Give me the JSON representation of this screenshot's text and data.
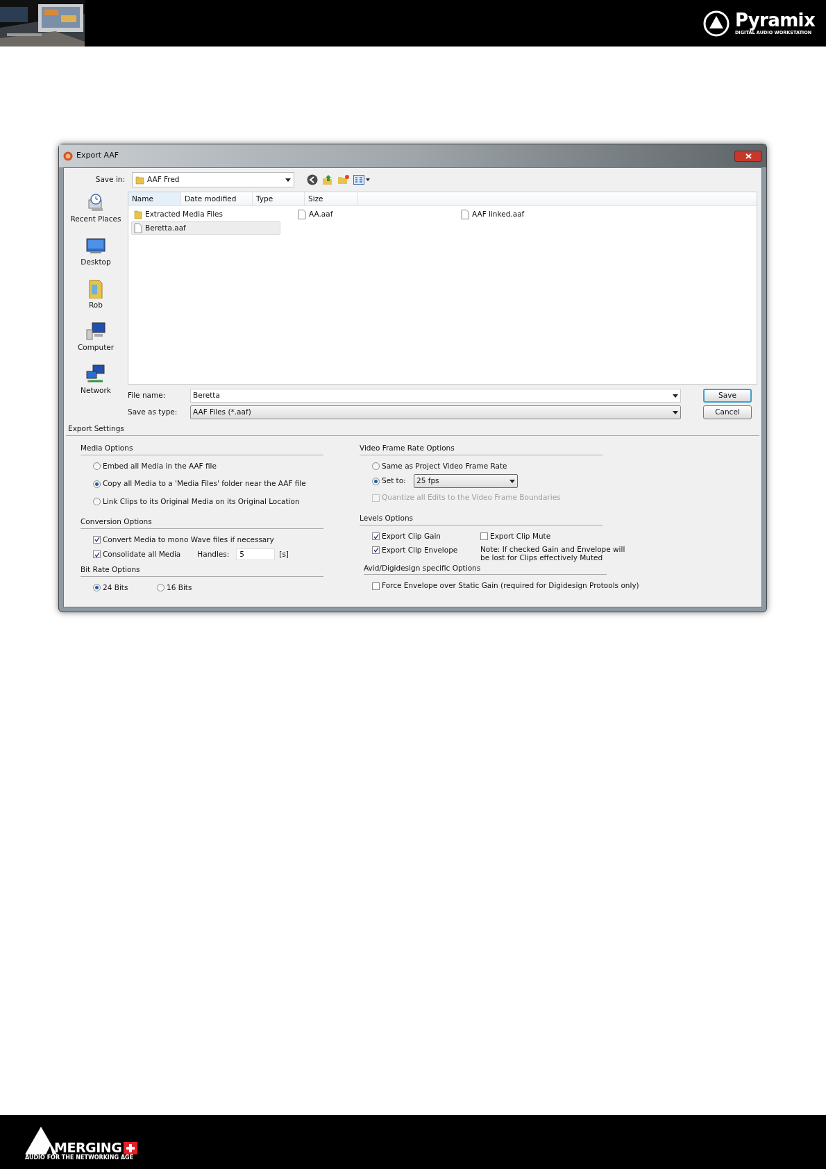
{
  "page_header": {
    "product": "Pyramix",
    "tagline": "DIGITAL AUDIO WORKSTATION"
  },
  "dialog": {
    "title": "Export AAF",
    "save_in": {
      "label": "Save in:",
      "value": "AAF Fred"
    },
    "places": [
      {
        "label": "Recent Places",
        "kind": "recent"
      },
      {
        "label": "Desktop",
        "kind": "desktop"
      },
      {
        "label": "Rob",
        "kind": "user"
      },
      {
        "label": "Computer",
        "kind": "computer"
      },
      {
        "label": "Network",
        "kind": "network"
      }
    ],
    "columns": [
      "Name",
      "Date modified",
      "Type",
      "Size"
    ],
    "files": [
      {
        "name": "Extracted Media Files",
        "kind": "folder",
        "selected": false
      },
      {
        "name": "AA.aaf",
        "kind": "file",
        "selected": false
      },
      {
        "name": "AAF linked.aaf",
        "kind": "file",
        "selected": false
      },
      {
        "name": "Beretta.aaf",
        "kind": "file",
        "selected": true
      }
    ],
    "file_name": {
      "label": "File name:",
      "value": "Beretta"
    },
    "save_as_type": {
      "label": "Save as type:",
      "value": "AAF Files (*.aaf)"
    },
    "buttons": [
      "Save",
      "Cancel"
    ],
    "export_settings": {
      "title": "Export Settings",
      "media_options": {
        "title": "Media Options",
        "options": [
          {
            "label": "Embed all Media in the AAF file",
            "selected": false
          },
          {
            "label": "Copy all Media to a 'Media Files' folder near the AAF file",
            "selected": true
          },
          {
            "label": "Link Clips to its Original Media on its Original Location",
            "selected": false
          }
        ]
      },
      "conversion_options": {
        "title": "Conversion Options",
        "convert": {
          "label": "Convert Media to mono Wave files if necessary",
          "checked": true
        },
        "consolidate": {
          "label": "Consolidate all Media",
          "checked": true
        },
        "handles": {
          "label": "Handles:",
          "value": "5",
          "unit": "[s]"
        }
      },
      "bit_rate_options": {
        "title": "Bit Rate Options",
        "options": [
          {
            "label": "24 Bits",
            "selected": true
          },
          {
            "label": "16 Bits",
            "selected": false
          }
        ]
      },
      "video_frame_rate_options": {
        "title": "Video Frame Rate Options",
        "options": [
          {
            "label": "Same as Project Video Frame Rate",
            "selected": false
          },
          {
            "label": "Set to:",
            "selected": true
          }
        ],
        "rate": "25 fps",
        "quantize": {
          "label": "Quantize all Edits to the Video Frame Boundaries",
          "checked": false,
          "disabled": true
        }
      },
      "levels_options": {
        "title": "Levels Options",
        "clip_gain": {
          "label": "Export Clip Gain",
          "checked": true
        },
        "clip_envelope": {
          "label": "Export Clip Envelope",
          "checked": true
        },
        "clip_mute": {
          "label": "Export Clip Mute",
          "checked": false
        },
        "note": "Note: If checked Gain and Envelope will be lost for Clips effectively Muted"
      },
      "avid_options": {
        "title": "Avid/Digidesign specific Options",
        "force_envelope": {
          "label": "Force Envelope over Static Gain (required for Digidesign Protools only)",
          "checked": false
        }
      }
    }
  },
  "page_footer": {
    "brand": "MERGING",
    "tagline": "AUDIO FOR THE NETWORKING AGE"
  }
}
